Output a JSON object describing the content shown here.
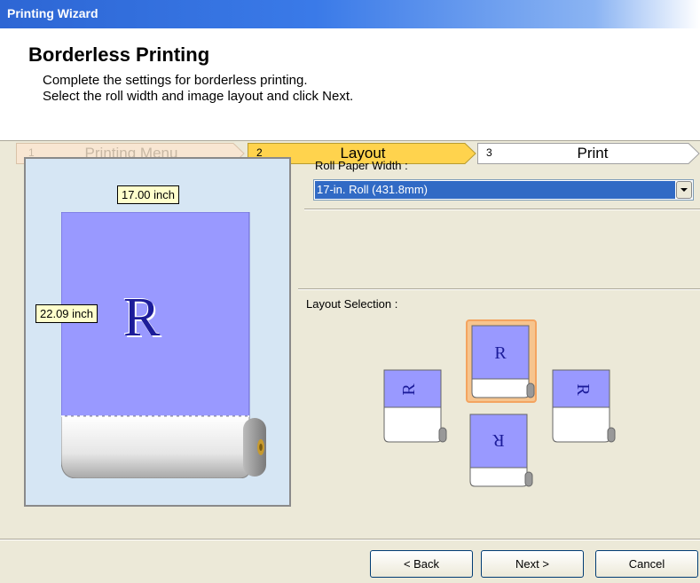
{
  "window": {
    "title": "Printing Wizard"
  },
  "header": {
    "title": "Borderless Printing",
    "description_line1": "Complete the settings for borderless printing.",
    "description_line2": "Select the roll width and image layout and click Next."
  },
  "steps": [
    {
      "num": "1",
      "label": "Printing Menu",
      "state": "done"
    },
    {
      "num": "2",
      "label": "Layout",
      "state": "current"
    },
    {
      "num": "3",
      "label": "Print",
      "state": "upcoming"
    }
  ],
  "preview": {
    "width_label": "17.00 inch",
    "height_label": "22.09 inch",
    "letter": "R"
  },
  "roll_paper": {
    "label": "Roll Paper Width :",
    "selected": "17-in. Roll (431.8mm)"
  },
  "layout_selection": {
    "label": "Layout Selection :",
    "options": [
      {
        "letter": "R",
        "rotation": "up",
        "selected": true
      },
      {
        "letter": "R",
        "rotation": "left",
        "selected": false
      },
      {
        "letter": "R",
        "rotation": "right",
        "selected": false
      },
      {
        "letter": "R",
        "rotation": "down",
        "selected": false
      }
    ]
  },
  "buttons": {
    "back": "< Back",
    "next": "Next >",
    "cancel": "Cancel"
  },
  "colors": {
    "title_bar": "#3a7ae8",
    "paper": "#9999ff",
    "step_current": "#ffd34d",
    "step_done": "#f8e6d2",
    "selection_highlight": "#f6c48e",
    "dropdown_selected": "#316ac5"
  }
}
